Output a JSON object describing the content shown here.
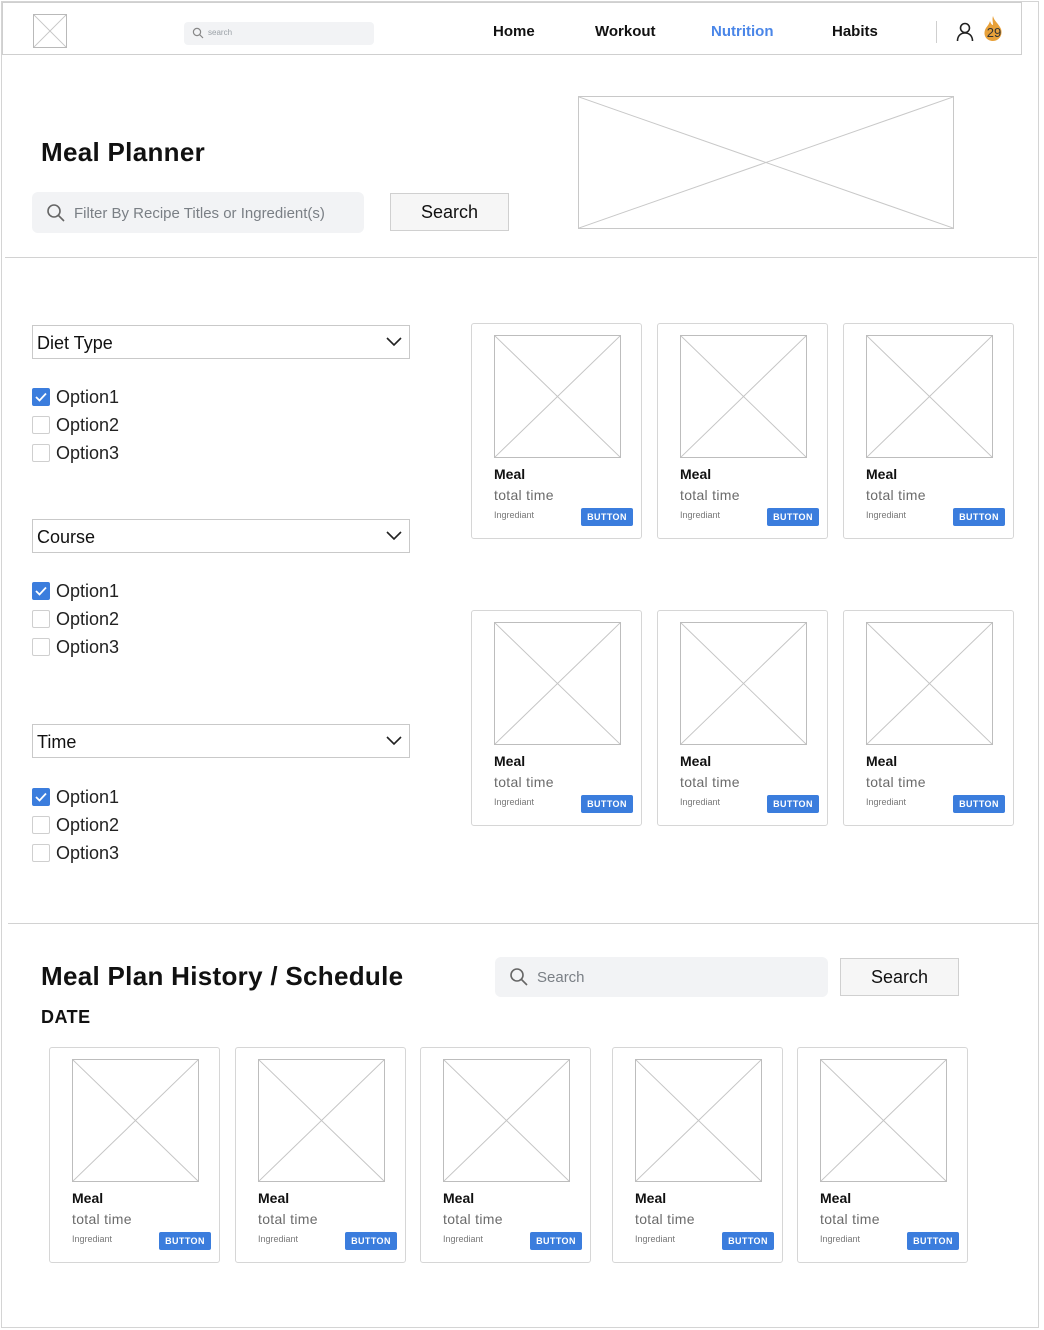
{
  "nav": {
    "search_placeholder": "search",
    "links": [
      "Home",
      "Workout",
      "Nutrition",
      "Habits"
    ],
    "active": "Nutrition",
    "streak_count": "29",
    "streak_color": "#e8a13a",
    "accent": "#4a86e8"
  },
  "hero": {
    "title": "Meal Planner",
    "filter_placeholder": "Filter By Recipe Titles or Ingredient(s)",
    "search_button": "Search"
  },
  "filters": [
    {
      "label": "Diet Type",
      "options": [
        {
          "label": "Option1",
          "checked": true
        },
        {
          "label": "Option2",
          "checked": false
        },
        {
          "label": "Option3",
          "checked": false
        }
      ]
    },
    {
      "label": "Course",
      "options": [
        {
          "label": "Option1",
          "checked": true
        },
        {
          "label": "Option2",
          "checked": false
        },
        {
          "label": "Option3",
          "checked": false
        }
      ]
    },
    {
      "label": "Time",
      "options": [
        {
          "label": "Option1",
          "checked": true
        },
        {
          "label": "Option2",
          "checked": false
        },
        {
          "label": "Option3",
          "checked": false
        }
      ]
    }
  ],
  "card_template": {
    "meal": "Meal",
    "time": "total time",
    "ingredient": "Ingrediant",
    "button": "BUTTON"
  },
  "history": {
    "title": "Meal Plan History / Schedule",
    "search_placeholder": "Search",
    "search_button": "Search",
    "date_label": "DATE"
  },
  "colors": {
    "primary_button": "#3b7ddd",
    "checkbox_checked": "#3b7ddd"
  }
}
